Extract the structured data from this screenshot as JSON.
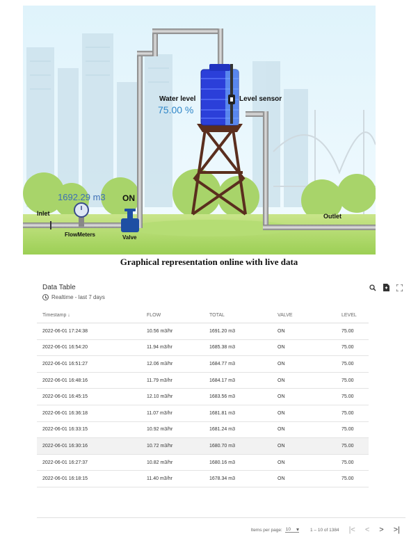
{
  "scene": {
    "water_level_label": "Water level",
    "water_level_value": "75.00 %",
    "water_level_fraction": 0.75,
    "level_sensor_label": "Level sensor",
    "flow_total": "1692.29 m3",
    "valve_state": "ON",
    "inlet_label": "Inlet",
    "flowmeters_label": "FlowMeters",
    "valve_label": "Valve",
    "outlet_label": "Outlet"
  },
  "caption": "Graphical representation online with live data",
  "table": {
    "title": "Data Table",
    "subtitle": "Realtime - last 7 days",
    "columns": [
      "Timestamp ↓",
      "FLOW",
      "TOTAL",
      "VALVE",
      "LEVEL"
    ],
    "rows": [
      [
        "2022-06-01 17:24:38",
        "10.56 m3/hr",
        "1691.20 m3",
        "ON",
        "75.00"
      ],
      [
        "2022-06-01 16:54:20",
        "11.94 m3/hr",
        "1685.38 m3",
        "ON",
        "75.00"
      ],
      [
        "2022-06-01 16:51:27",
        "12.06 m3/hr",
        "1684.77 m3",
        "ON",
        "75.00"
      ],
      [
        "2022-06-01 16:48:16",
        "11.79 m3/hr",
        "1684.17 m3",
        "ON",
        "75.00"
      ],
      [
        "2022-06-01 16:45:15",
        "12.10 m3/hr",
        "1683.56 m3",
        "ON",
        "75.00"
      ],
      [
        "2022-06-01 16:36:18",
        "11.07 m3/hr",
        "1681.81 m3",
        "ON",
        "75.00"
      ],
      [
        "2022-06-01 16:33:15",
        "10.92 m3/hr",
        "1681.24 m3",
        "ON",
        "75.00"
      ],
      [
        "2022-06-01 16:30:16",
        "10.72 m3/hr",
        "1680.70 m3",
        "ON",
        "75.00"
      ],
      [
        "2022-06-01 16:27:37",
        "10.82 m3/hr",
        "1680.16 m3",
        "ON",
        "75.00"
      ],
      [
        "2022-06-01 16:18:15",
        "11.40 m3/hr",
        "1678.34 m3",
        "ON",
        "75.00"
      ]
    ],
    "highlighted_row": 7,
    "icons": [
      "search-icon",
      "export-file-icon",
      "fullscreen-icon"
    ]
  },
  "pager": {
    "items_per_page_label": "Items per page:",
    "items_per_page": "10",
    "range": "1 – 10 of 1384",
    "first": "|<",
    "prev": "<",
    "next": ">",
    "last": ">|"
  }
}
